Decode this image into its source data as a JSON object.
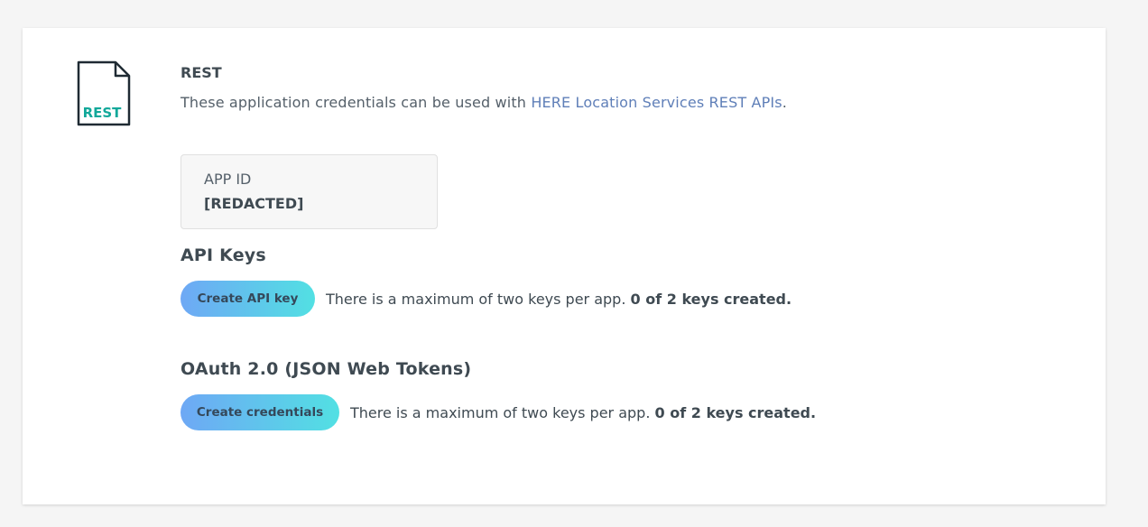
{
  "rest": {
    "icon_label": "REST",
    "title": "REST",
    "description_prefix": "These application credentials can be used with ",
    "description_link": "HERE Location Services REST APIs",
    "description_suffix": "."
  },
  "app_id": {
    "label": "APP ID",
    "value": "[REDACTED]"
  },
  "api_keys": {
    "heading": "API Keys",
    "button_label": "Create API key",
    "note": "There is a maximum of two keys per app.",
    "count": "0 of 2 keys created."
  },
  "oauth": {
    "heading": "OAuth 2.0 (JSON Web Tokens)",
    "button_label": "Create credentials",
    "note": "There is a maximum of two keys per app.",
    "count": "0 of 2 keys created."
  },
  "colors": {
    "icon_accent": "#12a89a",
    "link": "#5f7fb8",
    "button_gradient_start": "#6ea8f5",
    "button_gradient_end": "#52e0e3"
  }
}
